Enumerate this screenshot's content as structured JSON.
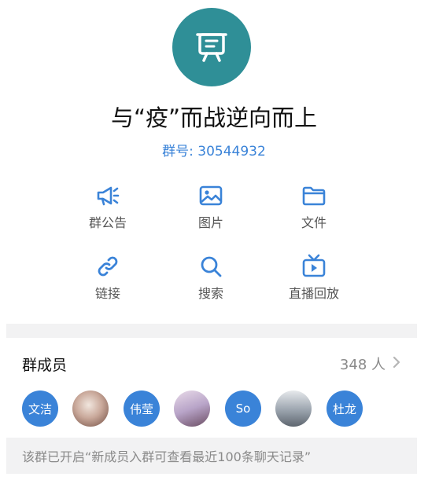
{
  "group": {
    "avatar_icon": "presentation-board-icon",
    "avatar_color": "#2f8f97",
    "title": "与“疫”而战逆向而上",
    "id_text": "群号: 30544932"
  },
  "functions": [
    {
      "label": "群公告",
      "icon": "megaphone-icon"
    },
    {
      "label": "图片",
      "icon": "image-icon"
    },
    {
      "label": "文件",
      "icon": "folder-icon"
    },
    {
      "label": "链接",
      "icon": "link-icon"
    },
    {
      "label": "搜索",
      "icon": "search-icon"
    },
    {
      "label": "直播回放",
      "icon": "tv-icon"
    }
  ],
  "members": {
    "title": "群成员",
    "count": "348 人",
    "avatars": [
      {
        "text": "文洁",
        "type": "text"
      },
      {
        "text": "",
        "type": "photo",
        "desc_color": "#c9a89a"
      },
      {
        "text": "伟莹",
        "type": "text"
      },
      {
        "text": "",
        "type": "photo",
        "desc_color": "#b8a4c8"
      },
      {
        "text": "So",
        "type": "text"
      },
      {
        "text": "",
        "type": "photo",
        "desc_color": "#9aa3ad"
      },
      {
        "text": "杜龙",
        "type": "text"
      }
    ]
  },
  "notice": "该群已开启“新成员入群可查看最近100条聊天记录”",
  "colors": {
    "accent": "#3a83d8",
    "muted": "#8a8a8a",
    "band": "#f2f2f3"
  }
}
